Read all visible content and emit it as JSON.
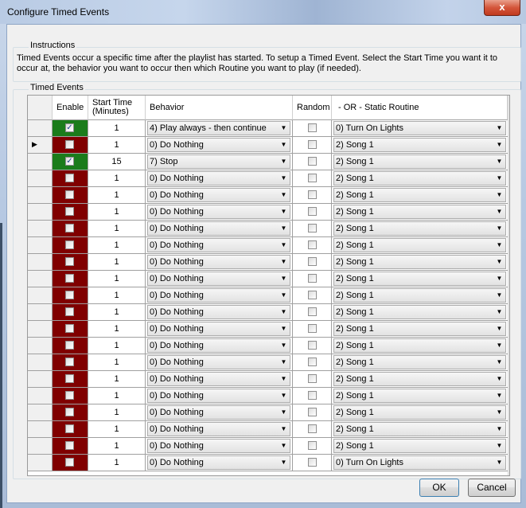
{
  "window": {
    "title": "Configure Timed Events",
    "close_label": "x"
  },
  "instructions": {
    "group_label": "Instructions",
    "text": "Timed Events occur a specific time after the playlist has started. To setup a Timed Event. Select the Start Time you want it to occur at, the behavior you want to occur then which Routine you want to play (if needed)."
  },
  "timed_events": {
    "group_label": "Timed Events",
    "columns": {
      "enable": "Enable",
      "start_time_1": "Start Time",
      "start_time_2": "(Minutes)",
      "behavior": "Behavior",
      "random": "Random",
      "routine": "-  OR  -  Static Routine"
    },
    "rows": [
      {
        "enabled": true,
        "start": "1",
        "behavior": "4) Play always - then continue",
        "random": false,
        "routine": "0) Turn On Lights",
        "current": false
      },
      {
        "enabled": false,
        "start": "1",
        "behavior": "0) Do Nothing",
        "random": false,
        "routine": "2) Song 1",
        "current": true
      },
      {
        "enabled": true,
        "start": "15",
        "behavior": "7) Stop",
        "random": false,
        "routine": "2) Song 1",
        "current": false
      },
      {
        "enabled": false,
        "start": "1",
        "behavior": "0) Do Nothing",
        "random": false,
        "routine": "2) Song 1",
        "current": false
      },
      {
        "enabled": false,
        "start": "1",
        "behavior": "0) Do Nothing",
        "random": false,
        "routine": "2) Song 1",
        "current": false
      },
      {
        "enabled": false,
        "start": "1",
        "behavior": "0) Do Nothing",
        "random": false,
        "routine": "2) Song 1",
        "current": false
      },
      {
        "enabled": false,
        "start": "1",
        "behavior": "0) Do Nothing",
        "random": false,
        "routine": "2) Song 1",
        "current": false
      },
      {
        "enabled": false,
        "start": "1",
        "behavior": "0) Do Nothing",
        "random": false,
        "routine": "2) Song 1",
        "current": false
      },
      {
        "enabled": false,
        "start": "1",
        "behavior": "0) Do Nothing",
        "random": false,
        "routine": "2) Song 1",
        "current": false
      },
      {
        "enabled": false,
        "start": "1",
        "behavior": "0) Do Nothing",
        "random": false,
        "routine": "2) Song 1",
        "current": false
      },
      {
        "enabled": false,
        "start": "1",
        "behavior": "0) Do Nothing",
        "random": false,
        "routine": "2) Song 1",
        "current": false
      },
      {
        "enabled": false,
        "start": "1",
        "behavior": "0) Do Nothing",
        "random": false,
        "routine": "2) Song 1",
        "current": false
      },
      {
        "enabled": false,
        "start": "1",
        "behavior": "0) Do Nothing",
        "random": false,
        "routine": "2) Song 1",
        "current": false
      },
      {
        "enabled": false,
        "start": "1",
        "behavior": "0) Do Nothing",
        "random": false,
        "routine": "2) Song 1",
        "current": false
      },
      {
        "enabled": false,
        "start": "1",
        "behavior": "0) Do Nothing",
        "random": false,
        "routine": "2) Song 1",
        "current": false
      },
      {
        "enabled": false,
        "start": "1",
        "behavior": "0) Do Nothing",
        "random": false,
        "routine": "2) Song 1",
        "current": false
      },
      {
        "enabled": false,
        "start": "1",
        "behavior": "0) Do Nothing",
        "random": false,
        "routine": "2) Song 1",
        "current": false
      },
      {
        "enabled": false,
        "start": "1",
        "behavior": "0) Do Nothing",
        "random": false,
        "routine": "2) Song 1",
        "current": false
      },
      {
        "enabled": false,
        "start": "1",
        "behavior": "0) Do Nothing",
        "random": false,
        "routine": "2) Song 1",
        "current": false
      },
      {
        "enabled": false,
        "start": "1",
        "behavior": "0) Do Nothing",
        "random": false,
        "routine": "2) Song 1",
        "current": false
      },
      {
        "enabled": false,
        "start": "1",
        "behavior": "0) Do Nothing",
        "random": false,
        "routine": "0) Turn On Lights",
        "current": false
      }
    ],
    "colors": {
      "enabled": "#1b7c1b",
      "disabled": "#800000"
    }
  },
  "buttons": {
    "ok": "OK",
    "cancel": "Cancel"
  }
}
